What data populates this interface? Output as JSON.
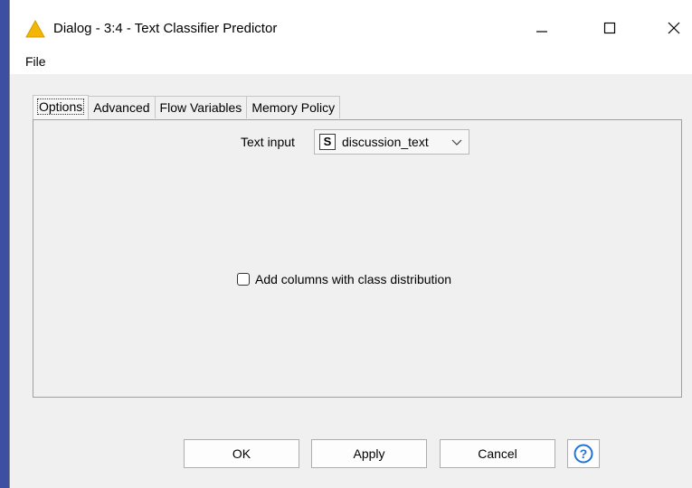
{
  "window": {
    "title": "Dialog - 3:4 - Text Classifier Predictor",
    "icon": "warning-triangle-icon",
    "controls": {
      "minimize": "minimize-icon",
      "maximize": "maximize-icon",
      "close": "close-icon"
    }
  },
  "menu": {
    "items": [
      "File"
    ]
  },
  "tabs": [
    {
      "label": "Options",
      "active": true
    },
    {
      "label": "Advanced",
      "active": false
    },
    {
      "label": "Flow Variables",
      "active": false
    },
    {
      "label": "Memory Policy",
      "active": false
    }
  ],
  "options": {
    "text_input_label": "Text input",
    "text_input_type_badge": "S",
    "text_input_value": "discussion_text",
    "class_distribution_label": "Add columns with class distribution",
    "class_distribution_checked": false
  },
  "buttons": {
    "ok": "OK",
    "apply": "Apply",
    "cancel": "Cancel",
    "help_icon": "help-icon"
  },
  "colors": {
    "accent_icon": "#f2b705",
    "help_blue": "#1e73d6",
    "background": "#f0f0f0"
  }
}
